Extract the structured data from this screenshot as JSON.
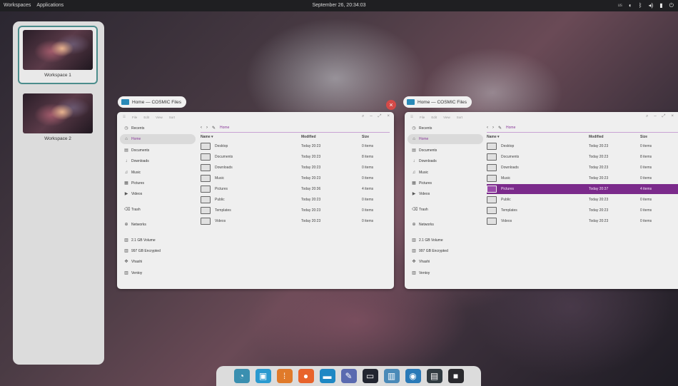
{
  "topbar": {
    "workspaces": "Workspaces",
    "applications": "Applications",
    "clock": "September 26, 20:34:03",
    "tray_lang": "us"
  },
  "workspaces": [
    {
      "label": "Workspace 1",
      "active": true
    },
    {
      "label": "Workspace 2",
      "active": false
    }
  ],
  "windows": [
    {
      "title": "Home — COSMIC Files",
      "menu": [
        "File",
        "Edit",
        "View",
        "Sort"
      ],
      "sidebar": [
        "Recents",
        "Home",
        "Documents",
        "Downloads",
        "Music",
        "Pictures",
        "Videos",
        "Trash",
        "Networks",
        "2.1 GB Volume",
        "997 GB Encrypted",
        "Vhashi",
        "Ventoy"
      ],
      "breadcrumb": "Home",
      "columns": [
        "Name ▾",
        "Modified",
        "Size"
      ],
      "rows": [
        {
          "name": "Desktop",
          "modified": "Today 20:23",
          "size": "0 items"
        },
        {
          "name": "Documents",
          "modified": "Today 20:23",
          "size": "8 items"
        },
        {
          "name": "Downloads",
          "modified": "Today 20:23",
          "size": "0 items"
        },
        {
          "name": "Music",
          "modified": "Today 20:23",
          "size": "0 items"
        },
        {
          "name": "Pictures",
          "modified": "Today 20:36",
          "size": "4 items"
        },
        {
          "name": "Public",
          "modified": "Today 20:23",
          "size": "0 items"
        },
        {
          "name": "Templates",
          "modified": "Today 20:23",
          "size": "0 items"
        },
        {
          "name": "Videos",
          "modified": "Today 20:23",
          "size": "0 items"
        }
      ]
    },
    {
      "title": "Home — COSMIC Files",
      "menu": [
        "File",
        "Edit",
        "View",
        "Sort"
      ],
      "sidebar": [
        "Recents",
        "Home",
        "Documents",
        "Downloads",
        "Music",
        "Pictures",
        "Videos",
        "Trash",
        "Networks",
        "2.1 GB Volume",
        "997 GB Encrypted",
        "Vhashi",
        "Ventoy"
      ],
      "breadcrumb": "Home",
      "columns": [
        "Name ▾",
        "Modified",
        "Size"
      ],
      "rows": [
        {
          "name": "Desktop",
          "modified": "Today 20:23",
          "size": "0 items"
        },
        {
          "name": "Documents",
          "modified": "Today 20:23",
          "size": "8 items"
        },
        {
          "name": "Downloads",
          "modified": "Today 20:23",
          "size": "0 items"
        },
        {
          "name": "Music",
          "modified": "Today 20:23",
          "size": "0 items"
        },
        {
          "name": "Pictures",
          "modified": "Today 20:37",
          "size": "4 items"
        },
        {
          "name": "Public",
          "modified": "Today 20:23",
          "size": "0 items"
        },
        {
          "name": "Templates",
          "modified": "Today 20:23",
          "size": "0 items"
        },
        {
          "name": "Videos",
          "modified": "Today 20:23",
          "size": "0 items"
        }
      ]
    }
  ],
  "dock": [
    {
      "name": "launcher-icon",
      "glyph": "◔",
      "color": "#3a8fb0"
    },
    {
      "name": "workspaces-icon",
      "glyph": "▣",
      "color": "#2a9ad0"
    },
    {
      "name": "app-grid-icon",
      "glyph": "⁞",
      "color": "#e07a2a"
    },
    {
      "name": "firefox-icon",
      "glyph": "●",
      "color": "#e8632b"
    },
    {
      "name": "files-icon",
      "glyph": "▬",
      "color": "#1e88c4"
    },
    {
      "name": "editor-icon",
      "glyph": "✎",
      "color": "#5a6ab0"
    },
    {
      "name": "terminal-icon",
      "glyph": "▭",
      "color": "#222530"
    },
    {
      "name": "store-icon",
      "glyph": "▥",
      "color": "#4a8ab8"
    },
    {
      "name": "settings-icon",
      "glyph": "◉",
      "color": "#2a7ab8"
    },
    {
      "name": "monitor-icon",
      "glyph": "▤",
      "color": "#303a40"
    },
    {
      "name": "screen-icon",
      "glyph": "■",
      "color": "#2a2a2e"
    }
  ]
}
